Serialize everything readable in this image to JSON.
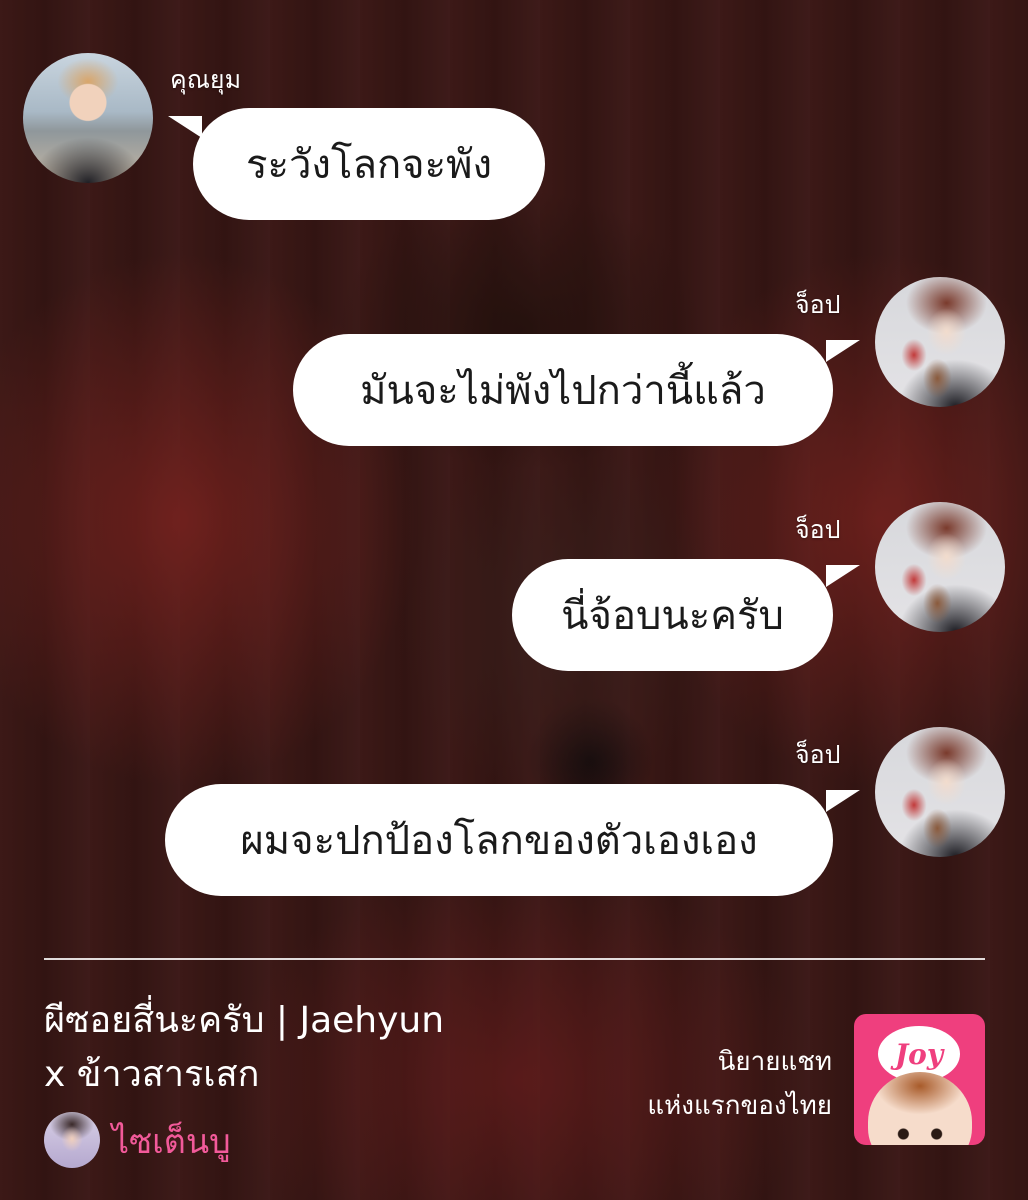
{
  "messages": [
    {
      "sender": "คุณยุม",
      "text": "ระวังโลกจะพัง",
      "side": "left",
      "avatar_icon": "avatar-yum-photo"
    },
    {
      "sender": "จ็อป",
      "text": "มันจะไม่พังไปกว่านี้แล้ว",
      "side": "right",
      "avatar_icon": "avatar-jop-photo"
    },
    {
      "sender": "จ็อป",
      "text": "นี่จ้อบนะครับ",
      "side": "right",
      "avatar_icon": "avatar-jop-photo"
    },
    {
      "sender": "จ็อป",
      "text": "ผมจะปกป้องโลกของตัวเองเอง",
      "side": "right",
      "avatar_icon": "avatar-jop-photo"
    }
  ],
  "footer": {
    "story_title_line1": "ผีซอยสี่นะครับ | Jaehyun",
    "story_title_line2": "x ข้าวสารเสก",
    "author": "ไซเต็นบู",
    "tagline_line1": "นิยายแชท",
    "tagline_line2": "แห่งแรกของไทย",
    "app_logo_text": "Joy"
  },
  "colors": {
    "bubble": "#ffffff",
    "author_pink": "#f25a9a",
    "logo_pink": "#ef3f7e"
  }
}
